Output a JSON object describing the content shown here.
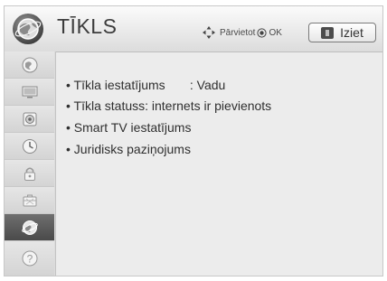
{
  "header": {
    "title": "TĪKLS",
    "navigate_hint": "Pārvietot",
    "ok_hint": "OK",
    "exit_label": "Iziet"
  },
  "sidebar": {
    "items": [
      {
        "name": "picture",
        "icon": "picture-settings-icon"
      },
      {
        "name": "screen",
        "icon": "monitor-icon"
      },
      {
        "name": "sound",
        "icon": "speaker-icon"
      },
      {
        "name": "time",
        "icon": "clock-icon"
      },
      {
        "name": "lock",
        "icon": "lock-icon"
      },
      {
        "name": "option",
        "icon": "briefcase-icon"
      },
      {
        "name": "network",
        "icon": "globe-icon",
        "active": true
      },
      {
        "name": "support",
        "icon": "help-icon"
      }
    ]
  },
  "menu": [
    {
      "label": "• Tīkla iestatījums       : Vadu"
    },
    {
      "label": "• Tīkla statuss: internets ir pievienots"
    },
    {
      "label": "• Smart TV iestatījums"
    },
    {
      "label": "• Juridisks paziņojums"
    }
  ],
  "colors": {
    "panel_bg": "#ececec",
    "sidebar_active": "#555555",
    "text": "#2f2f2f"
  }
}
